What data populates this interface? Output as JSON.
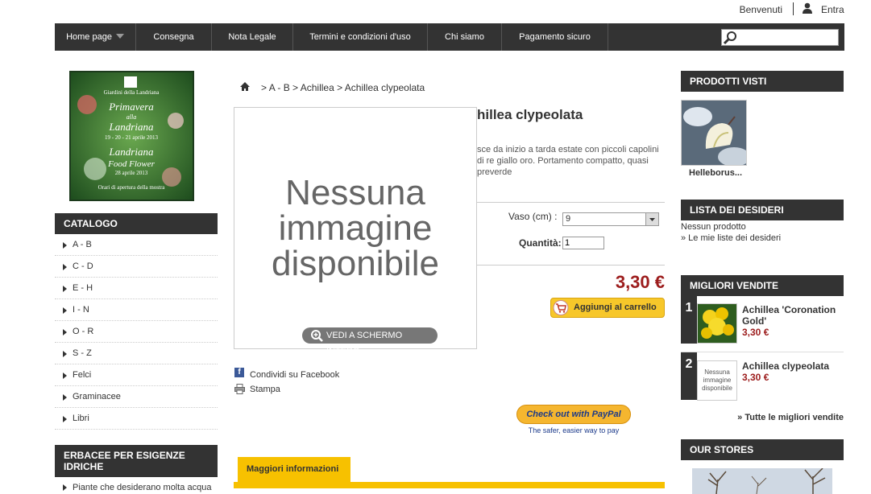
{
  "header": {
    "welcome_text": "Benvenuti",
    "login_label": "Entra"
  },
  "nav": {
    "items": [
      {
        "label": "Home page"
      },
      {
        "label": "Consegna"
      },
      {
        "label": "Nota Legale"
      },
      {
        "label": "Termini e condizioni d'uso"
      },
      {
        "label": "Chi siamo"
      },
      {
        "label": "Pagamento sicuro"
      }
    ],
    "search_value": ""
  },
  "banner": {
    "lines": [
      "Giardini della Landriana",
      "Primavera",
      "alla",
      "Landriana",
      "19 - 20 - 21 aprile 2013",
      "Landriana",
      "Food Flower",
      "28 aprile 2013",
      "Orari di apertura della mostra"
    ]
  },
  "catalog": {
    "heading": "CATALOGO",
    "items": [
      "A - B",
      "C - D",
      "E - H",
      "I - N",
      "O - R",
      "S - Z",
      "Felci",
      "Graminacee",
      "Libri"
    ]
  },
  "erbacee": {
    "heading": "ERBACEE PER ESIGENZE IDRICHE",
    "items": [
      "Piante che desiderano molta acqua"
    ]
  },
  "breadcrumb": {
    "sep": ">",
    "items": [
      "A - B",
      "Achillea",
      "Achillea clypeolata"
    ]
  },
  "product": {
    "no_image_text": "Nessuna immagine disponibile",
    "fullscreen_label": "VEDI A SCHERMO INTERO",
    "title": "hillea clypeolata",
    "description": "sce da inizio a tarda estate con piccoli capolini di re giallo oro. Portamento compatto, quasi preverde",
    "vaso_label": "Vaso (cm) :",
    "vaso_value": "9",
    "qty_label": "Quantità:",
    "qty_value": "1",
    "price": "3,30 €",
    "add_to_cart": "Aggiungi al carrello",
    "share_facebook": "Condividi su Facebook",
    "print": "Stampa",
    "paypal_label": "Check out with PayPal",
    "paypal_tagline": "The safer, easier way to pay",
    "info_tab": "Maggiori informazioni"
  },
  "viewed": {
    "heading": "PRODOTTI VISTI",
    "items": [
      {
        "name": "Helleborus..."
      }
    ]
  },
  "wishlist": {
    "heading": "LISTA DEI DESIDERI",
    "none": "Nessun prodotto",
    "link": "» Le mie liste dei desideri"
  },
  "bestsellers": {
    "heading": "MIGLIORI VENDITE",
    "items": [
      {
        "rank": "1",
        "name": "Achillea 'Coronation Gold'",
        "price": "3,30 €"
      },
      {
        "rank": "2",
        "name": "Achillea clypeolata",
        "price": "3,30 €",
        "thumb_text": "Nessuna immagine disponibile"
      }
    ],
    "all_link": "» Tutte le migliori vendite"
  },
  "stores": {
    "heading": "OUR STORES"
  },
  "colors": {
    "nav_bg": "#333333",
    "accent_yellow": "#f7c100",
    "price_red": "#9c1c1c"
  }
}
